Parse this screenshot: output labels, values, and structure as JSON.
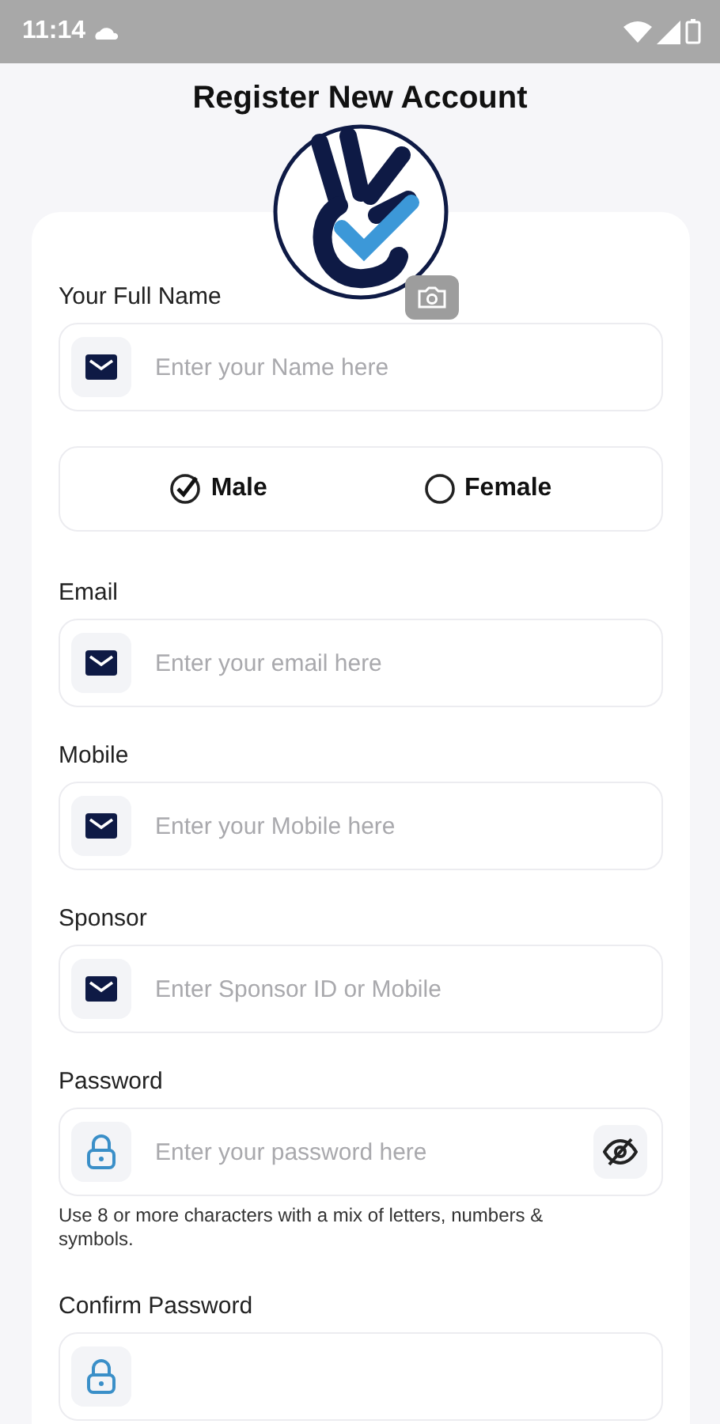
{
  "status_bar": {
    "time": "11:14"
  },
  "title": "Register New Account",
  "form": [
    {
      "kind": "field",
      "label": "Your Full Name",
      "placeholder": "Enter your Name here",
      "reveal_toggle": false
    },
    {
      "kind": "gender",
      "options": [
        {
          "label": "Male",
          "selected": true
        },
        {
          "label": "Female",
          "selected": false
        }
      ]
    },
    {
      "kind": "field",
      "label": "Email",
      "placeholder": "Enter your email here",
      "reveal_toggle": false
    },
    {
      "kind": "field",
      "label": "Mobile",
      "placeholder": "Enter your Mobile here",
      "reveal_toggle": false
    },
    {
      "kind": "field",
      "label": "Sponsor",
      "placeholder": "Enter Sponsor ID or Mobile",
      "reveal_toggle": false
    },
    {
      "kind": "password",
      "label": "Password",
      "placeholder": "Enter your password here",
      "reveal_toggle": true,
      "hint": "Use 8 or more characters with a mix of letters, numbers & symbols."
    },
    {
      "kind": "password",
      "label": "Confirm Password",
      "reveal_toggle": false
    }
  ]
}
